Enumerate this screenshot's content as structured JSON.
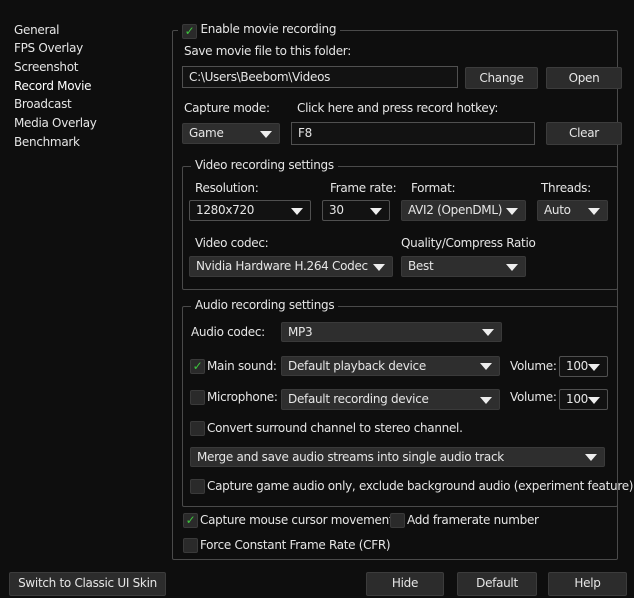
{
  "sidebar": {
    "items": [
      "General",
      "FPS Overlay",
      "Screenshot",
      "Record Movie",
      "Broadcast",
      "Media Overlay",
      "Benchmark"
    ]
  },
  "main": {
    "enable_label": "Enable movie recording",
    "enable_checked": true,
    "folder_label": "Save movie file to this folder:",
    "folder_value": "C:\\Users\\Beebom\\Videos",
    "change": "Change",
    "open": "Open",
    "capture_mode_label": "Capture mode:",
    "capture_mode": "Game",
    "hotkey_label": "Click here and press record hotkey:",
    "hotkey_value": "F8",
    "clear": "Clear"
  },
  "video": {
    "legend": "Video recording settings",
    "resolution_label": "Resolution:",
    "resolution": "1280x720",
    "framerate_label": "Frame rate:",
    "framerate": "30",
    "format_label": "Format:",
    "format": "AVI2 (OpenDML)",
    "threads_label": "Threads:",
    "threads": "Auto",
    "codec_label": "Video codec:",
    "codec": "Nvidia Hardware H.264 Codec",
    "quality_label": "Quality/Compress Ratio",
    "quality": "Best"
  },
  "audio": {
    "legend": "Audio recording settings",
    "codec_label": "Audio codec:",
    "codec": "MP3",
    "main_label": "Main sound:",
    "main_checked": true,
    "main_device": "Default playback device",
    "volume_label": "Volume:",
    "main_volume": "100",
    "mic_label": "Microphone:",
    "mic_checked": false,
    "mic_device": "Default recording device",
    "mic_volume": "100",
    "convert_label": "Convert surround channel to stereo channel.",
    "merge": "Merge and save audio streams into single audio track",
    "game_only_label": "Capture game audio only, exclude background audio (experiment feature)."
  },
  "options": {
    "cursor_label": "Capture mouse cursor movement",
    "cursor_checked": true,
    "framerate_label": "Add framerate number",
    "cfr_label": "Force Constant Frame Rate (CFR)"
  },
  "footer": {
    "classic": "Switch to Classic UI Skin",
    "hide": "Hide",
    "default": "Default",
    "help": "Help"
  },
  "check_glyph": "✓"
}
